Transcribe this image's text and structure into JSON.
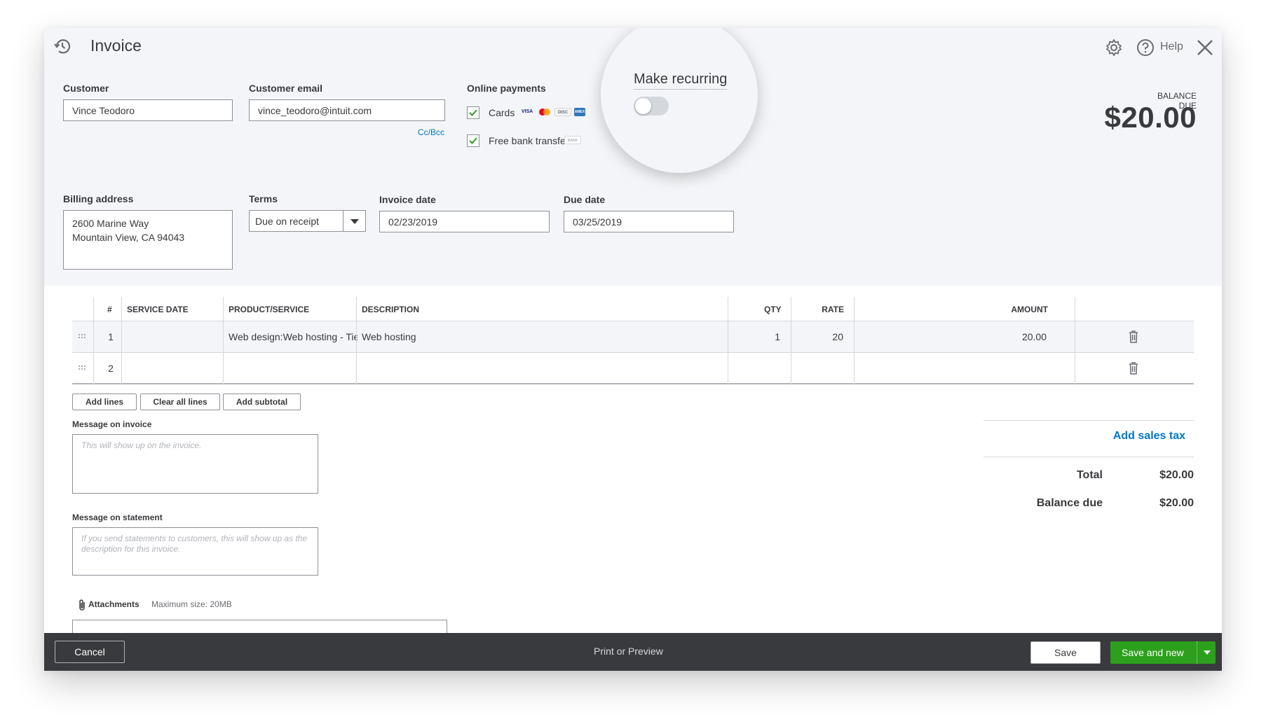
{
  "header": {
    "title": "Invoice",
    "help_label": "Help",
    "icons": {
      "history": "history-icon",
      "settings": "gear-icon",
      "help": "help-icon",
      "close": "close-icon"
    }
  },
  "customer": {
    "label": "Customer",
    "value": "Vince Teodoro"
  },
  "email": {
    "label": "Customer email",
    "value": "vince_teodoro@intuit.com",
    "cc_bcc": "Cc/Bcc"
  },
  "online_payments": {
    "label": "Online payments",
    "cards": {
      "label": "Cards",
      "checked": true,
      "logos": [
        "VISA",
        "MC",
        "DISC",
        "AMEX"
      ]
    },
    "bank": {
      "label": "Free bank transfer",
      "checked": true,
      "logo": "BANK"
    }
  },
  "recurring": {
    "label": "Make recurring",
    "enabled": false
  },
  "balance": {
    "label": "BALANCE DUE",
    "amount": "$20.00"
  },
  "billing": {
    "label": "Billing address",
    "line1": "2600 Marine Way",
    "line2": "Mountain View, CA 94043"
  },
  "terms": {
    "label": "Terms",
    "value": "Due on receipt"
  },
  "invoice_date": {
    "label": "Invoice date",
    "value": "02/23/2019"
  },
  "due_date": {
    "label": "Due date",
    "value": "03/25/2019"
  },
  "table": {
    "headers": {
      "num": "#",
      "service_date": "SERVICE DATE",
      "product": "PRODUCT/SERVICE",
      "description": "DESCRIPTION",
      "qty": "QTY",
      "rate": "RATE",
      "amount": "AMOUNT"
    },
    "rows": [
      {
        "num": "1",
        "service_date": "",
        "product": "Web design:Web hosting - Tie",
        "description": "Web hosting",
        "qty": "1",
        "rate": "20",
        "amount": "20.00"
      },
      {
        "num": "2",
        "service_date": "",
        "product": "",
        "description": "",
        "qty": "",
        "rate": "",
        "amount": ""
      }
    ]
  },
  "line_buttons": {
    "add": "Add lines",
    "clear": "Clear all lines",
    "subtotal": "Add subtotal"
  },
  "message_invoice": {
    "label": "Message on invoice",
    "placeholder": "This will show up on the invoice."
  },
  "message_statement": {
    "label": "Message on statement",
    "placeholder": "If you send statements to customers, this will show up as the description for this invoice."
  },
  "attachments": {
    "label": "Attachments",
    "max": "Maximum size: 20MB"
  },
  "totals": {
    "add_tax": "Add sales tax",
    "total_label": "Total",
    "total_value": "$20.00",
    "balance_label": "Balance due",
    "balance_value": "$20.00"
  },
  "footer": {
    "cancel": "Cancel",
    "print": "Print or Preview",
    "save": "Save",
    "save_new": "Save and new"
  },
  "colors": {
    "accent": "#0077c5",
    "primary_button": "#2ca01c",
    "footer_bg": "#393a3d",
    "panel_bg": "#f4f5f8"
  }
}
